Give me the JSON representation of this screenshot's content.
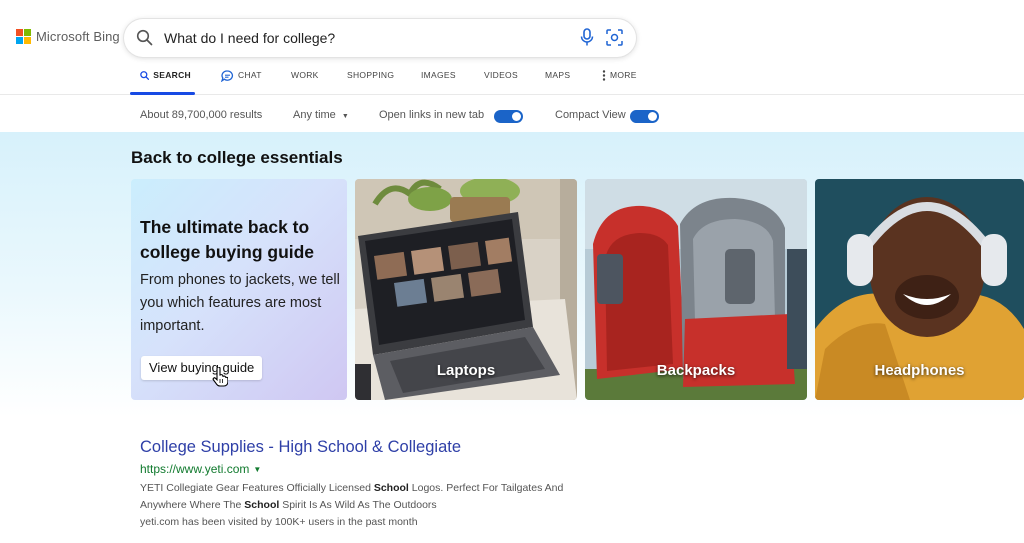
{
  "header": {
    "logo_text": "Microsoft Bing",
    "search_query": "What do I need for college?"
  },
  "tabs": [
    {
      "label": "SEARCH",
      "icon": "search-icon",
      "active": true
    },
    {
      "label": "CHAT",
      "icon": "chat-icon",
      "active": false
    },
    {
      "label": "WORK",
      "active": false
    },
    {
      "label": "SHOPPING",
      "active": false
    },
    {
      "label": "IMAGES",
      "active": false
    },
    {
      "label": "VIDEOS",
      "active": false
    },
    {
      "label": "MAPS",
      "active": false
    },
    {
      "label": "MORE",
      "icon": "more-vertical-icon",
      "active": false
    }
  ],
  "filters": {
    "result_count": "About 89,700,000 results",
    "time_filter": "Any time",
    "open_new_tab_label": "Open links in new tab",
    "open_new_tab_on": true,
    "compact_view_label": "Compact View",
    "compact_view_on": true
  },
  "essentials": {
    "title": "Back to college essentials",
    "guide_card": {
      "title": "The ultimate back to college buying guide",
      "description": "From phones to jackets, we tell you which features are most important.",
      "button_label": "View buying guide"
    },
    "cards": [
      {
        "label": "Laptops"
      },
      {
        "label": "Backpacks"
      },
      {
        "label": "Headphones"
      }
    ]
  },
  "result": {
    "title": "College Supplies - High School & Collegiate",
    "url": "https://www.yeti.com",
    "snippet_parts": [
      {
        "text": "YETI Collegiate Gear Features Officially Licensed ",
        "bold": false
      },
      {
        "text": "School",
        "bold": true
      },
      {
        "text": " Logos. Perfect For Tailgates And Anywhere Where The ",
        "bold": false
      },
      {
        "text": "School",
        "bold": true
      },
      {
        "text": " Spirit Is As Wild As The Outdoors",
        "bold": false
      }
    ],
    "visited": "yeti.com has been visited by 100K+ users in the past month"
  },
  "colors": {
    "accent": "#174ae4",
    "toggle": "#1b64c8",
    "link": "#2e3fa7",
    "url_green": "#117a2e"
  }
}
